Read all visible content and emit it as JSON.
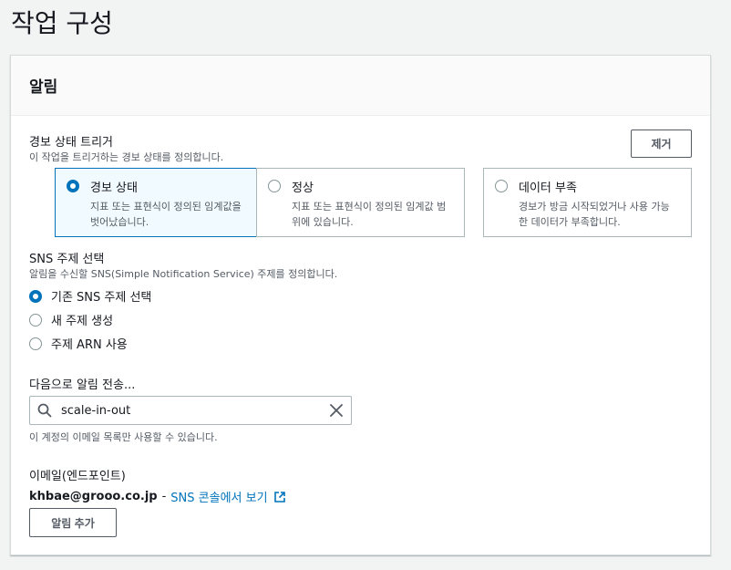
{
  "page": {
    "title": "작업 구성"
  },
  "panel": {
    "title": "알림"
  },
  "alarm_trigger": {
    "label": "경보 상태 트리거",
    "description": "이 작업을 트리거하는 경보 상태를 정의합니다.",
    "remove_label": "제거",
    "options": [
      {
        "title": "경보 상태",
        "desc_line1": "지표 또는 표현식이 정의된 임계값을",
        "desc_line2": "벗어났습니다.",
        "selected": true
      },
      {
        "title": "정상",
        "desc_line1": "지표 또는 표현식이 정의된 임계값 범",
        "desc_line2": "위에 있습니다.",
        "selected": false
      },
      {
        "title": "데이터 부족",
        "desc_line1": "경보가 방금 시작되었거나 사용 가능",
        "desc_line2": "한 데이터가 부족합니다.",
        "selected": false
      }
    ]
  },
  "sns_topic": {
    "label": "SNS 주제 선택",
    "description": "알림을 수신할 SNS(Simple Notification Service) 주제를 정의합니다.",
    "options": [
      {
        "label": "기존 SNS 주제 선택",
        "selected": true
      },
      {
        "label": "새 주제 생성",
        "selected": false
      },
      {
        "label": "주제 ARN 사용",
        "selected": false
      }
    ]
  },
  "send_to": {
    "label": "다음으로 알림 전송...",
    "value": "scale-in-out",
    "hint": "이 계정의 이메일 목록만 사용할 수 있습니다."
  },
  "endpoint": {
    "label": "이메일(엔드포인트)",
    "email": "khbae@grooo.co.jp",
    "separator": "-",
    "link_text": "SNS 콘솔에서 보기"
  },
  "add_notification_label": "알림 추가",
  "colors": {
    "accent": "#0073bb",
    "border": "#aab7b8",
    "muted_text": "#545b64"
  }
}
